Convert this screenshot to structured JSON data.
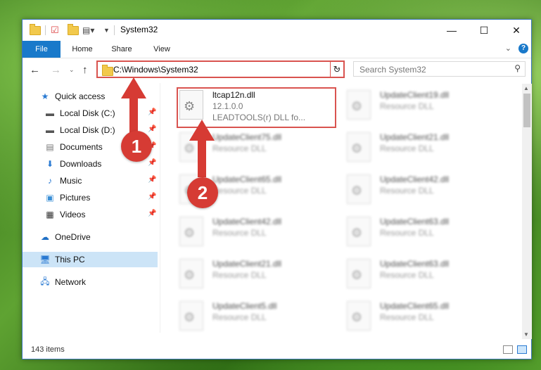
{
  "window": {
    "title": "System32",
    "controls": {
      "minimize": "—",
      "maximize": "☐",
      "close": "✕"
    }
  },
  "ribbon": {
    "tabs": [
      "File",
      "Home",
      "Share",
      "View"
    ],
    "help": "?"
  },
  "navigation": {
    "address": "C:\\Windows\\System32",
    "search_placeholder": "Search System32"
  },
  "sidebar": {
    "items": [
      {
        "label": "Quick access",
        "icon": "star-icon",
        "pinned": false
      },
      {
        "label": "Local Disk (C:)",
        "icon": "drive-icon",
        "pinned": true
      },
      {
        "label": "Local Disk (D:)",
        "icon": "drive-icon",
        "pinned": true
      },
      {
        "label": "Documents",
        "icon": "document-icon",
        "pinned": true
      },
      {
        "label": "Downloads",
        "icon": "download-icon",
        "pinned": true
      },
      {
        "label": "Music",
        "icon": "music-icon",
        "pinned": true
      },
      {
        "label": "Pictures",
        "icon": "pictures-icon",
        "pinned": true
      },
      {
        "label": "Videos",
        "icon": "videos-icon",
        "pinned": true
      },
      {
        "label": "OneDrive",
        "icon": "cloud-icon",
        "pinned": false
      },
      {
        "label": "This PC",
        "icon": "computer-icon",
        "pinned": false,
        "selected": true
      },
      {
        "label": "Network",
        "icon": "network-icon",
        "pinned": false
      }
    ]
  },
  "files": [
    {
      "name": "ltcap12n.dll",
      "version": "12.1.0.0",
      "description": "LEADTOOLS(r) DLL fo...",
      "highlighted": true
    },
    {
      "name": "UpdateClient19.dll",
      "description": "Resource DLL"
    },
    {
      "name": "UpdateClient75.dll",
      "description": "Resource DLL"
    },
    {
      "name": "UpdateClient21.dll",
      "description": "Resource DLL"
    },
    {
      "name": "UpdateClient65.dll",
      "description": "Resource DLL"
    },
    {
      "name": "UpdateClient42.dll",
      "description": "Resource DLL"
    },
    {
      "name": "UpdateClient42.dll",
      "description": "Resource DLL"
    },
    {
      "name": "UpdateClient63.dll",
      "description": "Resource DLL"
    },
    {
      "name": "UpdateClient21.dll",
      "description": "Resource DLL"
    },
    {
      "name": "UpdateClient63.dll",
      "description": "Resource DLL"
    },
    {
      "name": "UpdateClient5.dll",
      "description": "Resource DLL"
    },
    {
      "name": "UpdateClient65.dll",
      "description": "Resource DLL"
    }
  ],
  "status": {
    "item_count": "143 items"
  },
  "annotations": {
    "step1": "1",
    "step2": "2",
    "color": "#d63b34"
  }
}
